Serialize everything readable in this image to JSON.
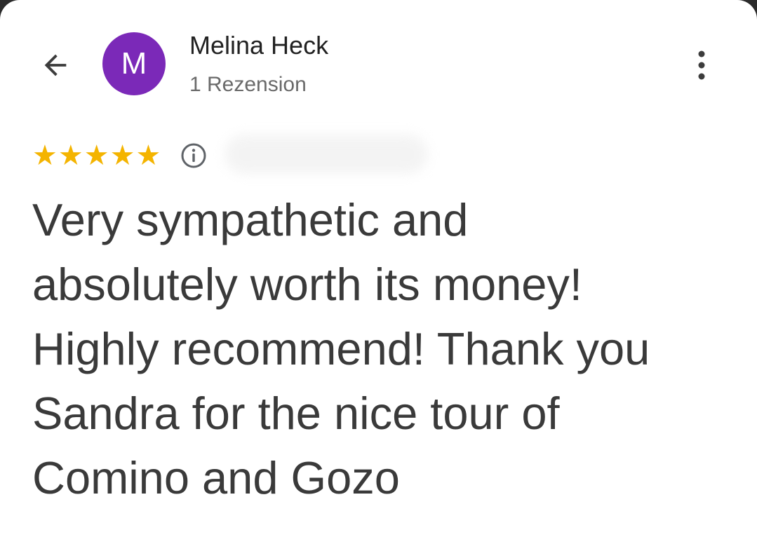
{
  "review": {
    "avatar_letter": "M",
    "reviewer_name": "Melina Heck",
    "review_count": "1 Rezension",
    "rating": 5,
    "stars": [
      "★",
      "★",
      "★",
      "★",
      "★"
    ],
    "text_lines": [
      "Very sympathetic and",
      "absolutely worth its money!",
      "Highly recommend! Thank you",
      "Sandra for the nice tour of",
      "Comino and Gozo"
    ]
  },
  "icons": {
    "back": "arrow-left-icon",
    "menu": "more-vert-icon",
    "info": "info-icon",
    "star": "star-icon"
  },
  "colors": {
    "avatar_bg": "#7b29b8",
    "star": "#f4b400"
  }
}
